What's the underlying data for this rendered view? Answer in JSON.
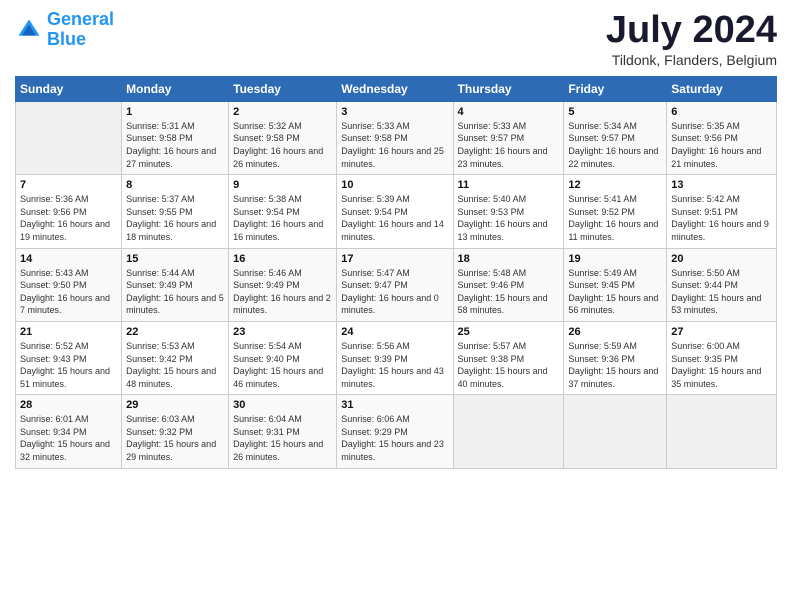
{
  "header": {
    "logo_line1": "General",
    "logo_line2": "Blue",
    "month_year": "July 2024",
    "location": "Tildonk, Flanders, Belgium"
  },
  "columns": [
    "Sunday",
    "Monday",
    "Tuesday",
    "Wednesday",
    "Thursday",
    "Friday",
    "Saturday"
  ],
  "weeks": [
    [
      {
        "day": "",
        "empty": true
      },
      {
        "day": "1",
        "sunrise": "5:31 AM",
        "sunset": "9:58 PM",
        "daylight": "16 hours and 27 minutes."
      },
      {
        "day": "2",
        "sunrise": "5:32 AM",
        "sunset": "9:58 PM",
        "daylight": "16 hours and 26 minutes."
      },
      {
        "day": "3",
        "sunrise": "5:33 AM",
        "sunset": "9:58 PM",
        "daylight": "16 hours and 25 minutes."
      },
      {
        "day": "4",
        "sunrise": "5:33 AM",
        "sunset": "9:57 PM",
        "daylight": "16 hours and 23 minutes."
      },
      {
        "day": "5",
        "sunrise": "5:34 AM",
        "sunset": "9:57 PM",
        "daylight": "16 hours and 22 minutes."
      },
      {
        "day": "6",
        "sunrise": "5:35 AM",
        "sunset": "9:56 PM",
        "daylight": "16 hours and 21 minutes."
      }
    ],
    [
      {
        "day": "7",
        "sunrise": "5:36 AM",
        "sunset": "9:56 PM",
        "daylight": "16 hours and 19 minutes."
      },
      {
        "day": "8",
        "sunrise": "5:37 AM",
        "sunset": "9:55 PM",
        "daylight": "16 hours and 18 minutes."
      },
      {
        "day": "9",
        "sunrise": "5:38 AM",
        "sunset": "9:54 PM",
        "daylight": "16 hours and 16 minutes."
      },
      {
        "day": "10",
        "sunrise": "5:39 AM",
        "sunset": "9:54 PM",
        "daylight": "16 hours and 14 minutes."
      },
      {
        "day": "11",
        "sunrise": "5:40 AM",
        "sunset": "9:53 PM",
        "daylight": "16 hours and 13 minutes."
      },
      {
        "day": "12",
        "sunrise": "5:41 AM",
        "sunset": "9:52 PM",
        "daylight": "16 hours and 11 minutes."
      },
      {
        "day": "13",
        "sunrise": "5:42 AM",
        "sunset": "9:51 PM",
        "daylight": "16 hours and 9 minutes."
      }
    ],
    [
      {
        "day": "14",
        "sunrise": "5:43 AM",
        "sunset": "9:50 PM",
        "daylight": "16 hours and 7 minutes."
      },
      {
        "day": "15",
        "sunrise": "5:44 AM",
        "sunset": "9:49 PM",
        "daylight": "16 hours and 5 minutes."
      },
      {
        "day": "16",
        "sunrise": "5:46 AM",
        "sunset": "9:49 PM",
        "daylight": "16 hours and 2 minutes."
      },
      {
        "day": "17",
        "sunrise": "5:47 AM",
        "sunset": "9:47 PM",
        "daylight": "16 hours and 0 minutes."
      },
      {
        "day": "18",
        "sunrise": "5:48 AM",
        "sunset": "9:46 PM",
        "daylight": "15 hours and 58 minutes."
      },
      {
        "day": "19",
        "sunrise": "5:49 AM",
        "sunset": "9:45 PM",
        "daylight": "15 hours and 56 minutes."
      },
      {
        "day": "20",
        "sunrise": "5:50 AM",
        "sunset": "9:44 PM",
        "daylight": "15 hours and 53 minutes."
      }
    ],
    [
      {
        "day": "21",
        "sunrise": "5:52 AM",
        "sunset": "9:43 PM",
        "daylight": "15 hours and 51 minutes."
      },
      {
        "day": "22",
        "sunrise": "5:53 AM",
        "sunset": "9:42 PM",
        "daylight": "15 hours and 48 minutes."
      },
      {
        "day": "23",
        "sunrise": "5:54 AM",
        "sunset": "9:40 PM",
        "daylight": "15 hours and 46 minutes."
      },
      {
        "day": "24",
        "sunrise": "5:56 AM",
        "sunset": "9:39 PM",
        "daylight": "15 hours and 43 minutes."
      },
      {
        "day": "25",
        "sunrise": "5:57 AM",
        "sunset": "9:38 PM",
        "daylight": "15 hours and 40 minutes."
      },
      {
        "day": "26",
        "sunrise": "5:59 AM",
        "sunset": "9:36 PM",
        "daylight": "15 hours and 37 minutes."
      },
      {
        "day": "27",
        "sunrise": "6:00 AM",
        "sunset": "9:35 PM",
        "daylight": "15 hours and 35 minutes."
      }
    ],
    [
      {
        "day": "28",
        "sunrise": "6:01 AM",
        "sunset": "9:34 PM",
        "daylight": "15 hours and 32 minutes."
      },
      {
        "day": "29",
        "sunrise": "6:03 AM",
        "sunset": "9:32 PM",
        "daylight": "15 hours and 29 minutes."
      },
      {
        "day": "30",
        "sunrise": "6:04 AM",
        "sunset": "9:31 PM",
        "daylight": "15 hours and 26 minutes."
      },
      {
        "day": "31",
        "sunrise": "6:06 AM",
        "sunset": "9:29 PM",
        "daylight": "15 hours and 23 minutes."
      },
      {
        "day": "",
        "empty": true
      },
      {
        "day": "",
        "empty": true
      },
      {
        "day": "",
        "empty": true
      }
    ]
  ],
  "labels": {
    "sunrise_prefix": "Sunrise: ",
    "sunset_prefix": "Sunset: ",
    "daylight_prefix": "Daylight: "
  }
}
